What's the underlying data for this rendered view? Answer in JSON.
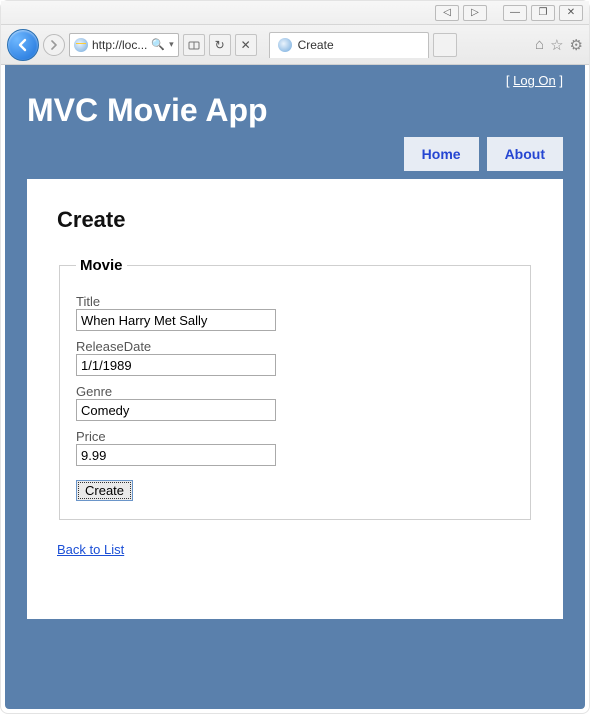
{
  "browser": {
    "url_text": "http://loc...",
    "search_icon_label": "🔍",
    "tab_title": "Create"
  },
  "win_buttons": {
    "prev": "◁",
    "next": "▷",
    "min": "—",
    "restore": "❐",
    "close": "✕"
  },
  "header": {
    "logon_link": "Log On",
    "app_title": "MVC Movie App",
    "nav": {
      "home": "Home",
      "about": "About"
    }
  },
  "page": {
    "heading": "Create",
    "legend": "Movie",
    "labels": {
      "title": "Title",
      "release": "ReleaseDate",
      "genre": "Genre",
      "price": "Price"
    },
    "values": {
      "title": "When Harry Met Sally",
      "release": "1/1/1989",
      "genre": "Comedy",
      "price": "9.99"
    },
    "submit": "Create",
    "back": "Back to List"
  }
}
